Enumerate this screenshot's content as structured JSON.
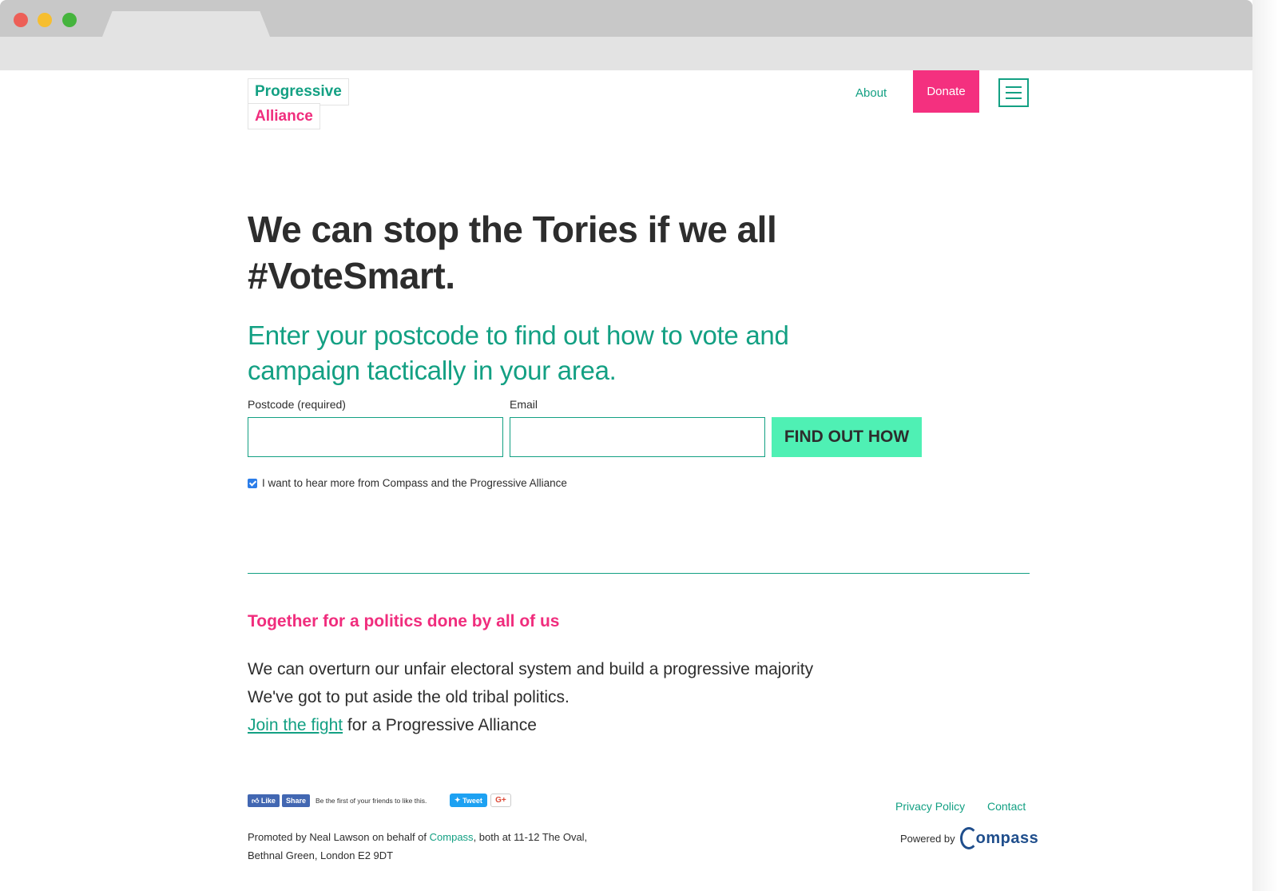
{
  "header": {
    "logo_line1": "Progressive",
    "logo_line2": "Alliance",
    "nav_about": "About",
    "nav_donate": "Donate"
  },
  "hero": {
    "headline_line1": "We can stop the Tories if we all",
    "headline_line2": "#VoteSmart.",
    "subhead": "Enter your postcode to find out how to vote and campaign tactically in your area."
  },
  "form": {
    "postcode_label": "Postcode (required)",
    "postcode_value": "",
    "email_label": "Email",
    "email_value": "",
    "submit_label": "FIND OUT HOW",
    "optin_checked": true,
    "optin_label": "I want to hear more from Compass and the Progressive Alliance"
  },
  "mission": {
    "title": "Together for a politics done by all of us",
    "line1": "We can overturn our unfair electoral system and build a progressive majority",
    "line2": "We've got to put aside the old tribal politics.",
    "link_text": "Join the fight",
    "line3_suffix": " for a Progressive Alliance"
  },
  "footer": {
    "fb_like": "Like",
    "fb_share": "Share",
    "fb_text": "Be the first of your friends to like this.",
    "tweet": "Tweet",
    "gplus": "G+",
    "promoted_prefix": "Promoted by Neal Lawson on behalf of ",
    "promoted_org": "Compass",
    "promoted_suffix": ", both at 11-12 The Oval,",
    "promoted_line2": "Bethnal Green, London E2 9DT",
    "privacy": "Privacy Policy",
    "contact": "Contact",
    "powered_by": "Powered by",
    "compass_logo_text": "ompass"
  },
  "colors": {
    "brand_green": "#13a083",
    "brand_pink": "#f02d7d",
    "button_mint": "#4ff0b4"
  }
}
